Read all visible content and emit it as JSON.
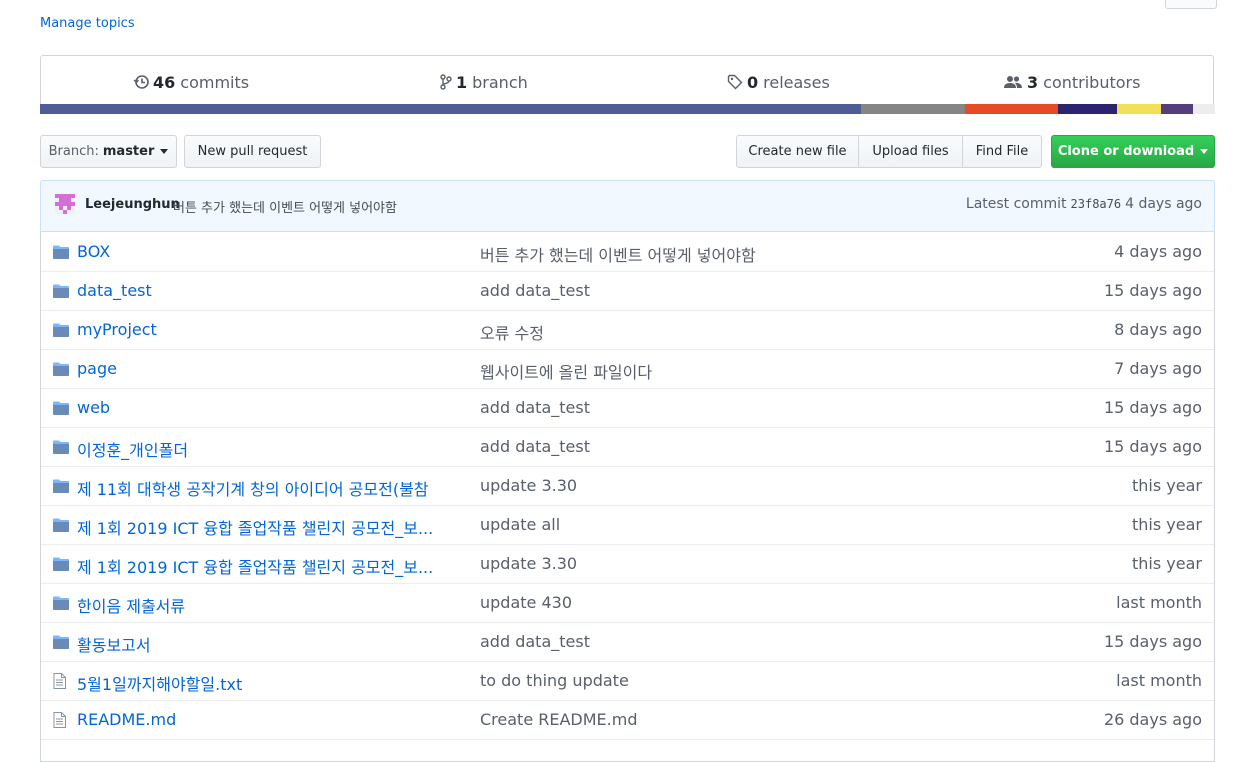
{
  "manage_topics": "Manage topics",
  "summary": {
    "commits": {
      "count": "46",
      "label": "commits"
    },
    "branches": {
      "count": "1",
      "label": "branch"
    },
    "releases": {
      "count": "0",
      "label": "releases"
    },
    "contributors": {
      "count": "3",
      "label": "contributors"
    }
  },
  "language_bar": {
    "segments": [
      {
        "color": "#4f5d95",
        "percent": 69.9
      },
      {
        "color": "#858585",
        "percent": 8.8
      },
      {
        "color": "#e34c26",
        "percent": 7.9
      },
      {
        "color": "#2b2270",
        "percent": 5.1
      },
      {
        "color": "#f1e05a",
        "percent": 3.7
      },
      {
        "color": "#563d7c",
        "percent": 2.7
      },
      {
        "color": "#ededed",
        "percent": 1.9
      }
    ]
  },
  "toolbar": {
    "branch_label": "Branch:",
    "branch_value": "master",
    "new_pull_request": "New pull request",
    "create_new_file": "Create new file",
    "upload_files": "Upload files",
    "find_file": "Find File",
    "clone_or_download": "Clone or download"
  },
  "latest_commit": {
    "author": "Leejeunghun",
    "message": "버튼 추가 했는데 이벤트 어떻게 넣어야함",
    "prefix": "Latest commit",
    "sha": "23f8a76",
    "age": "4 days ago"
  },
  "files": [
    {
      "type": "folder",
      "icon": "folder-icon",
      "name": "BOX",
      "message": "버튼 추가 했는데 이벤트 어떻게 넣어야함",
      "age": "4 days ago"
    },
    {
      "type": "folder",
      "icon": "folder-icon",
      "name": "data_test",
      "message": "add data_test",
      "age": "15 days ago"
    },
    {
      "type": "folder",
      "icon": "folder-icon",
      "name": "myProject",
      "message": "오류 수정",
      "age": "8 days ago"
    },
    {
      "type": "folder",
      "icon": "folder-icon",
      "name": "page",
      "message": "웹사이트에 올린 파일이다",
      "age": "7 days ago"
    },
    {
      "type": "folder",
      "icon": "folder-icon",
      "name": "web",
      "message": "add data_test",
      "age": "15 days ago"
    },
    {
      "type": "folder",
      "icon": "folder-icon",
      "name": "이정훈_개인폴더",
      "message": "add data_test",
      "age": "15 days ago"
    },
    {
      "type": "folder",
      "icon": "folder-icon",
      "name": "제 11회 대학생 공작기계 창의 아이디어 공모전(불참",
      "message": "update 3.30",
      "age": "this year"
    },
    {
      "type": "folder",
      "icon": "folder-icon",
      "name": "제 1회 2019 ICT 융합 졸업작품 챌린지 공모전_보...",
      "message": "update all",
      "age": "this year"
    },
    {
      "type": "folder",
      "icon": "folder-icon",
      "name": "제 1회 2019 ICT 융합 졸업작품 챌린지 공모전_보...",
      "message": "update 3.30",
      "age": "this year"
    },
    {
      "type": "folder",
      "icon": "folder-icon",
      "name": "한이음 제출서류",
      "message": "update 430",
      "age": "last month"
    },
    {
      "type": "folder",
      "icon": "folder-icon",
      "name": "활동보고서",
      "message": "add data_test",
      "age": "15 days ago"
    },
    {
      "type": "file",
      "icon": "file-icon",
      "name": "5월1일까지해야할일.txt",
      "message": "to do thing update",
      "age": "last month"
    },
    {
      "type": "file",
      "icon": "file-icon",
      "name": "README.md",
      "message": "Create README.md",
      "age": "26 days ago"
    }
  ]
}
